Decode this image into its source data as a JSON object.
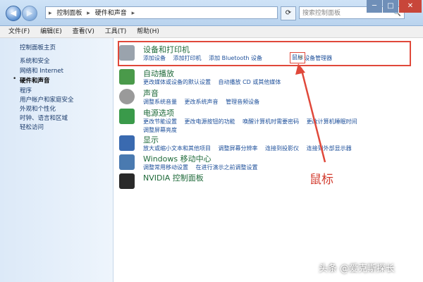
{
  "window": {
    "back_label": "◀",
    "forward_label": "▶",
    "address_crumbs": [
      "控制面板",
      "硬件和声音"
    ],
    "refresh_label": "⟳",
    "search_placeholder": "搜索控制面板",
    "search_icon": "🔍",
    "minimize": "─",
    "maximize": "□",
    "close": "✕"
  },
  "menu": [
    "文件(F)",
    "编辑(E)",
    "查看(V)",
    "工具(T)",
    "帮助(H)"
  ],
  "sidebar": {
    "items": [
      {
        "label": "控制面板主页"
      },
      {
        "label": "系统和安全"
      },
      {
        "label": "网络和 Internet"
      },
      {
        "label": "硬件和声音",
        "current": true
      },
      {
        "label": "程序"
      },
      {
        "label": "用户帐户和家庭安全"
      },
      {
        "label": "外观和个性化"
      },
      {
        "label": "时钟、语言和区域"
      },
      {
        "label": "轻松访问"
      }
    ]
  },
  "categories": [
    {
      "title": "设备和打印机",
      "icon": "printer-icon",
      "icon_color": "#9aa3ad",
      "links": [
        "添加设备",
        "添加打印机",
        "添加 Bluetooth 设备",
        "鼠标",
        "设备管理器"
      ]
    },
    {
      "title": "自动播放",
      "icon": "autoplay-icon",
      "icon_color": "#4a9a4a",
      "links": [
        "更改媒体或设备的默认设置",
        "自动播放 CD 或其他媒体"
      ]
    },
    {
      "title": "声音",
      "icon": "speaker-icon",
      "icon_color": "#9a9a9a",
      "links": [
        "调整系统音量",
        "更改系统声音",
        "管理音频设备"
      ]
    },
    {
      "title": "电源选项",
      "icon": "battery-icon",
      "icon_color": "#3a9a4a",
      "links": [
        "更改节能设置",
        "更改电源按钮的功能",
        "唤醒计算机时需要密码",
        "更改计算机睡眠时间",
        "调整屏幕亮度"
      ]
    },
    {
      "title": "显示",
      "icon": "monitor-icon",
      "icon_color": "#3a6ab0",
      "links": [
        "放大或缩小文本和其他项目",
        "调整屏幕分辨率",
        "连接到投影仪",
        "连接到外部显示器"
      ]
    },
    {
      "title": "Windows 移动中心",
      "icon": "mobility-center-icon",
      "icon_color": "#4a7ab0",
      "links": [
        "调整常用移动设置",
        "在进行演示之前调整设置"
      ]
    },
    {
      "title": "NVIDIA 控制面板",
      "icon": "nvidia-icon",
      "icon_color": "#2a2a2a",
      "links": []
    }
  ],
  "annotation": "鼠标",
  "watermark": "头条 @爱克斯探长",
  "colors": {
    "highlight": "#e0483a",
    "link": "#1d4f9a",
    "category_title": "#1f6a3a"
  }
}
